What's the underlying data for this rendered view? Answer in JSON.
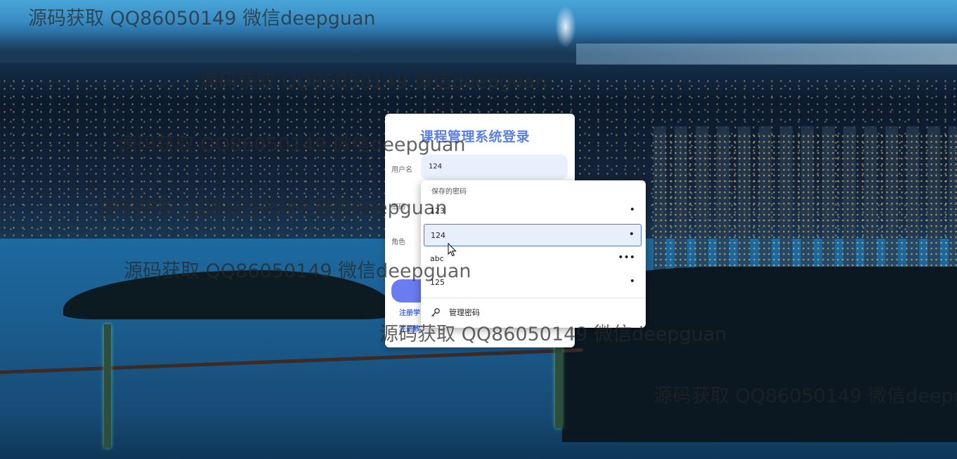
{
  "watermark": {
    "text": "源码获取 QQ86050149 微信deepguan"
  },
  "login": {
    "title": "课程管理系统登录",
    "username_label": "用户名",
    "username_value": "124",
    "password_label_partial": "密码",
    "role_label": "角色",
    "register_link_1": "注册学",
    "register_link_2": "注册教"
  },
  "autofill": {
    "header": "保存的密码",
    "items": [
      {
        "value": "123",
        "masked": "•"
      },
      {
        "value": "124",
        "masked": "•"
      },
      {
        "value": "abc",
        "masked": "•••"
      },
      {
        "value": "125",
        "masked": "•"
      }
    ],
    "manage_label": "管理密码"
  },
  "icons": {
    "key": "key-icon",
    "cursor": "mouse-pointer-icon"
  }
}
